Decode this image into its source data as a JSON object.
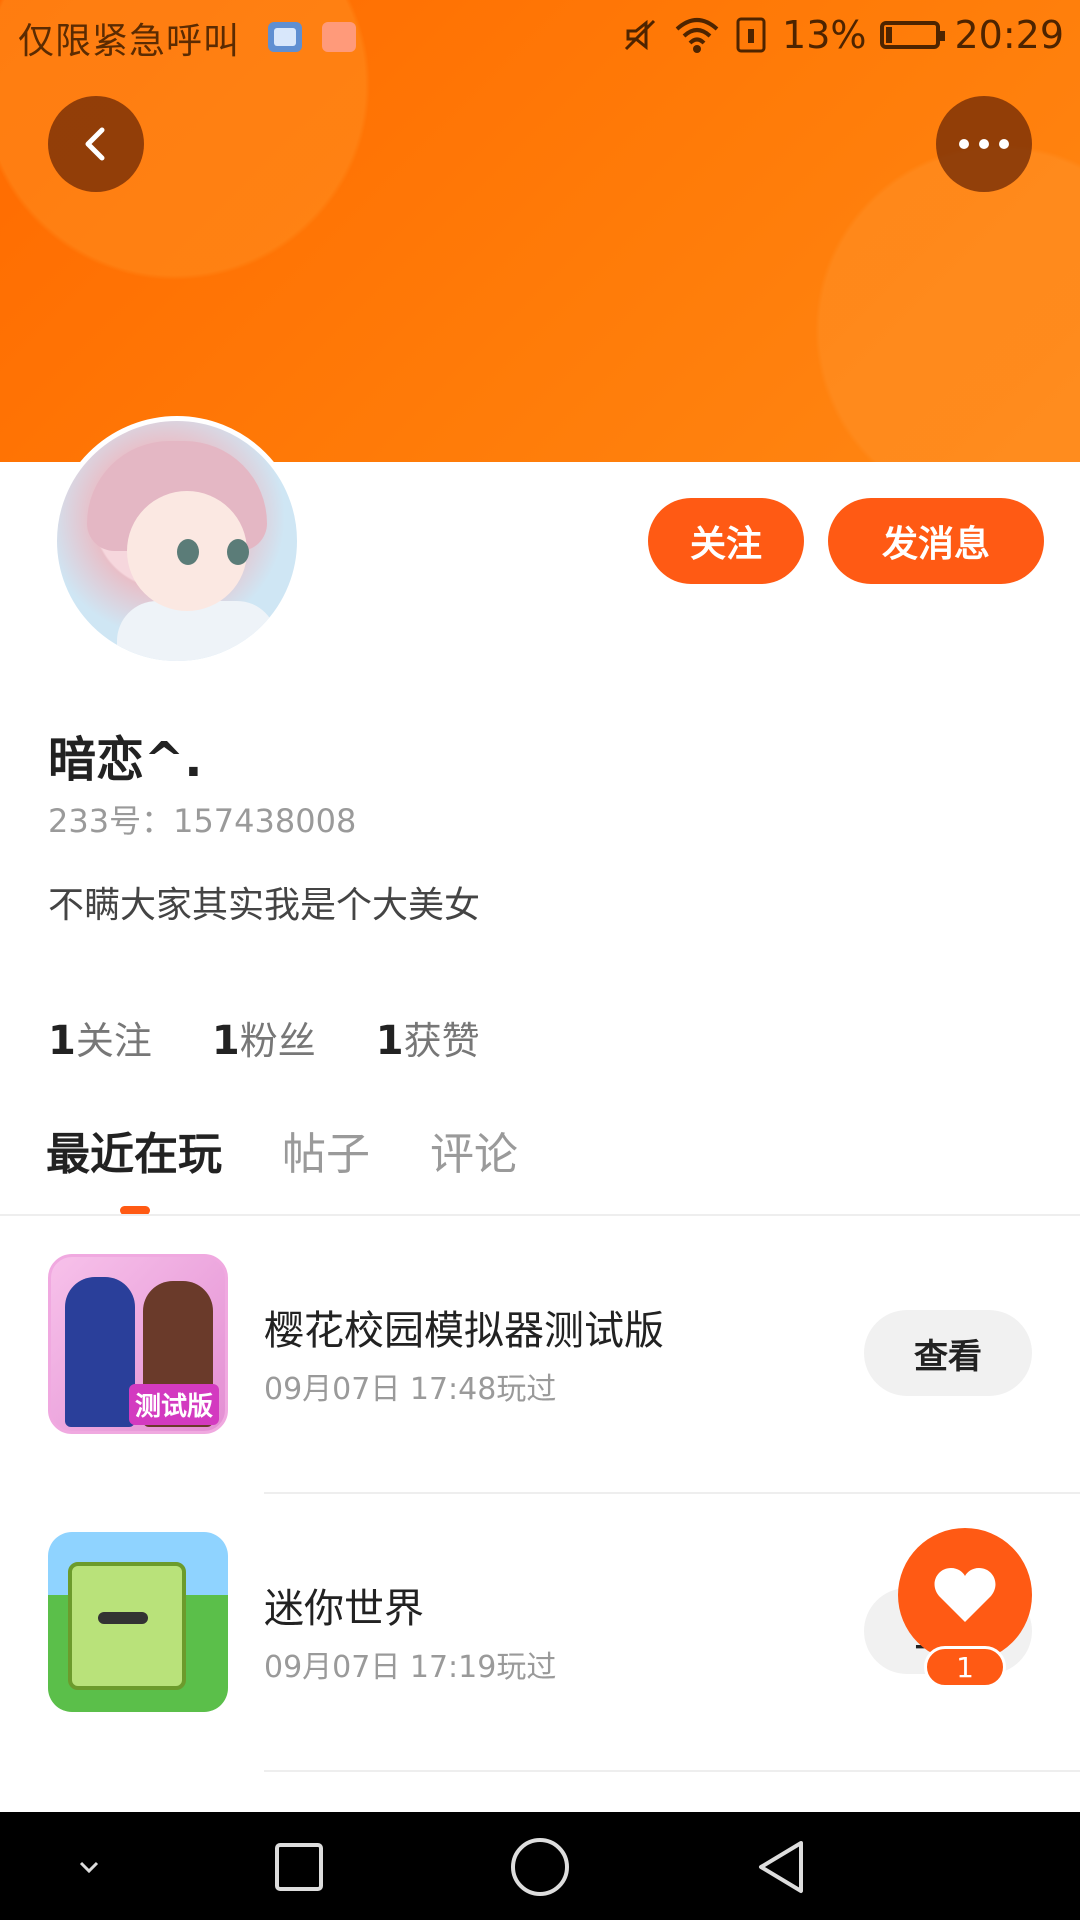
{
  "status_bar": {
    "carrier_text": "仅限紧急呼叫",
    "battery_percent": "13%",
    "battery_level": 0.13,
    "time": "20:29"
  },
  "header": {
    "back_icon": "chevron-left-icon",
    "more_icon": "more-dots-icon"
  },
  "profile": {
    "follow_label": "关注",
    "message_label": "发消息",
    "name": "暗恋^.",
    "uid": "233号：157438008",
    "bio": "不瞒大家其实我是个大美女",
    "stats": [
      {
        "count": "1",
        "label": "关注"
      },
      {
        "count": "1",
        "label": "粉丝"
      },
      {
        "count": "1",
        "label": "获赞"
      }
    ]
  },
  "tabs": [
    {
      "label": "最近在玩",
      "active": true
    },
    {
      "label": "帖子"
    },
    {
      "label": "评论"
    }
  ],
  "games": [
    {
      "title": "樱花校园模拟器测试版",
      "time": "09月07日 17:48玩过",
      "action": "查看",
      "icon_badge": "测试版"
    },
    {
      "title": "迷你世界",
      "time": "09月07日 17:19玩过",
      "action": "查看"
    }
  ],
  "fab": {
    "icon": "heart-icon",
    "badge": "1"
  },
  "colors": {
    "accent": "#ff5a14",
    "header": "#ff7b08"
  }
}
